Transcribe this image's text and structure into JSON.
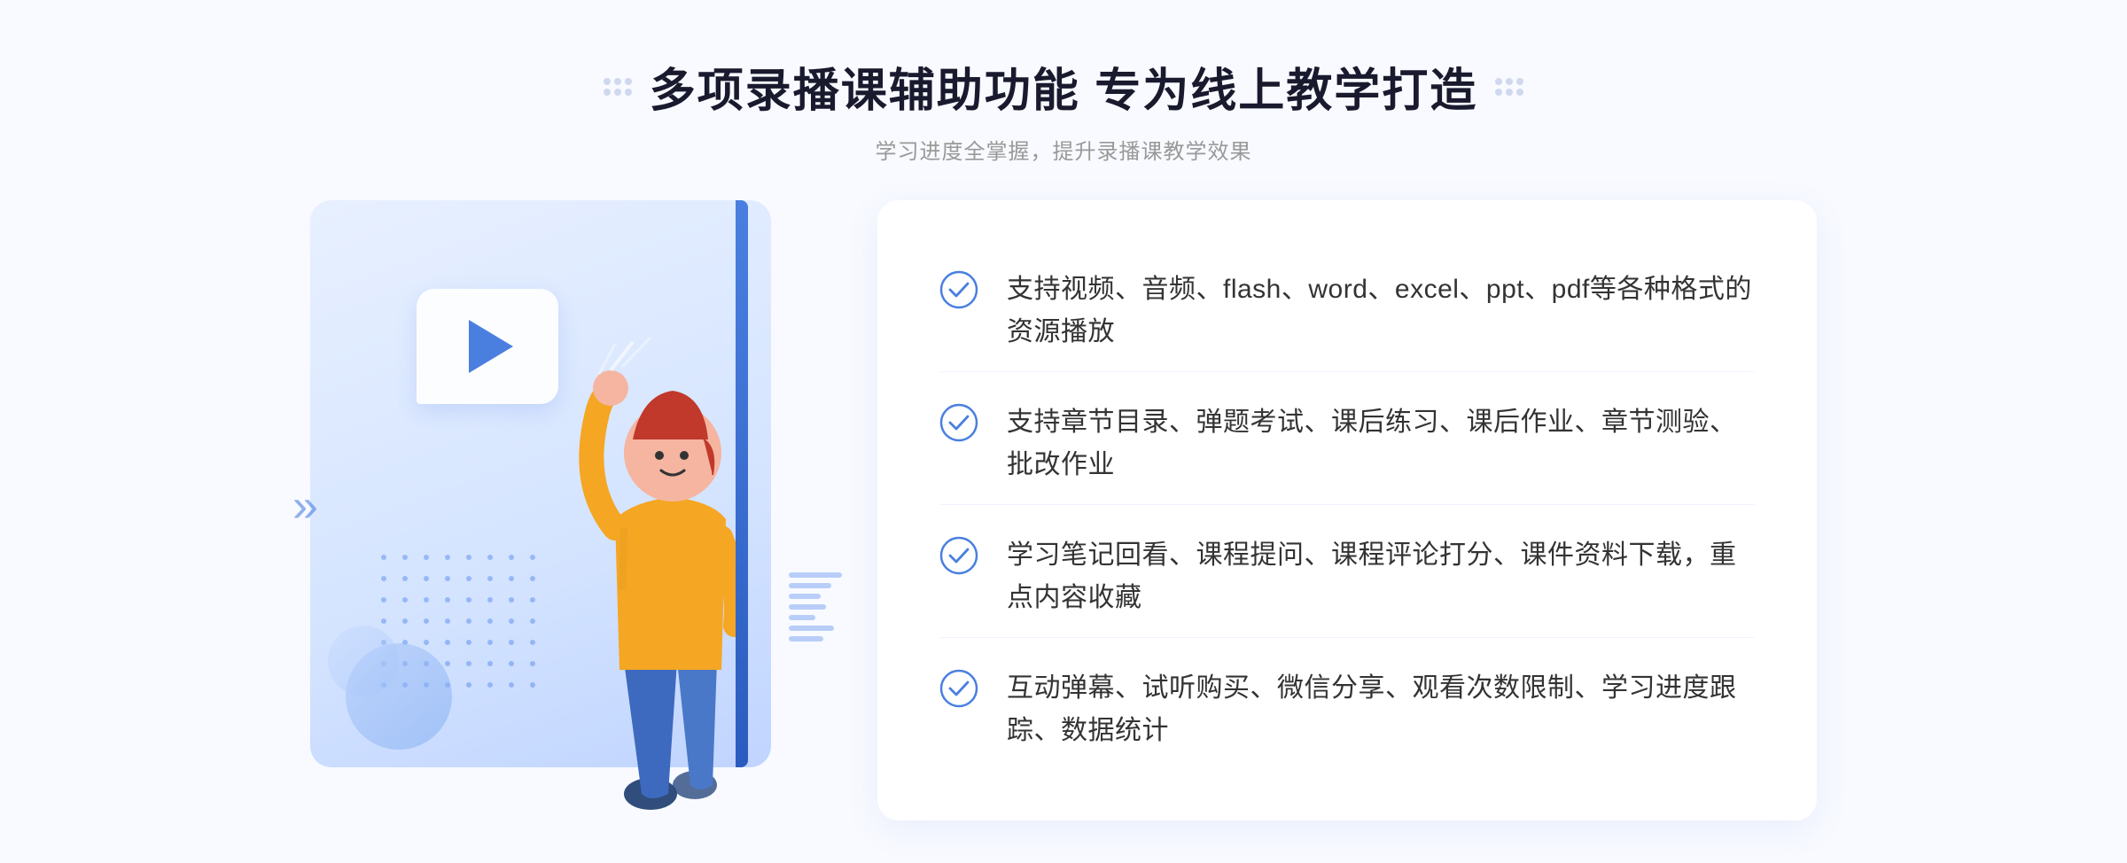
{
  "header": {
    "title": "多项录播课辅助功能 专为线上教学打造",
    "subtitle": "学习进度全掌握，提升录播课教学效果",
    "title_dots_left": "decorative-dots",
    "title_dots_right": "decorative-dots"
  },
  "features": [
    {
      "id": 1,
      "text": "支持视频、音频、flash、word、excel、ppt、pdf等各种格式的资源播放"
    },
    {
      "id": 2,
      "text": "支持章节目录、弹题考试、课后练习、课后作业、章节测验、批改作业"
    },
    {
      "id": 3,
      "text": "学习笔记回看、课程提问、课程评论打分、课件资料下载，重点内容收藏"
    },
    {
      "id": 4,
      "text": "互动弹幕、试听购买、微信分享、观看次数限制、学习进度跟踪、数据统计"
    }
  ],
  "colors": {
    "primary_blue": "#4a7fe0",
    "light_blue": "#e8f0ff",
    "text_dark": "#1a1a2e",
    "text_gray": "#999999",
    "text_body": "#333333",
    "accent": "#5b8dee"
  },
  "decoration": {
    "chevron": "»",
    "play_icon": "▶"
  }
}
